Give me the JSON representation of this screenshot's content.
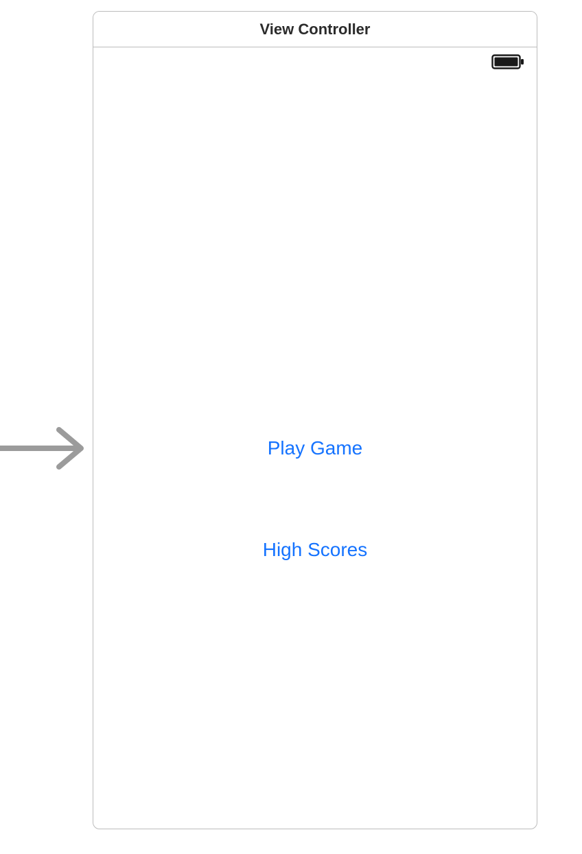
{
  "scene": {
    "title": "View Controller"
  },
  "buttons": {
    "play": "Play Game",
    "highScores": "High Scores"
  },
  "icons": {
    "battery": "battery-full-icon",
    "entryArrow": "storyboard-entry-arrow"
  },
  "colors": {
    "linkBlue": "#1573ff",
    "border": "#bcbcbc",
    "titleText": "#2b2b2b"
  }
}
